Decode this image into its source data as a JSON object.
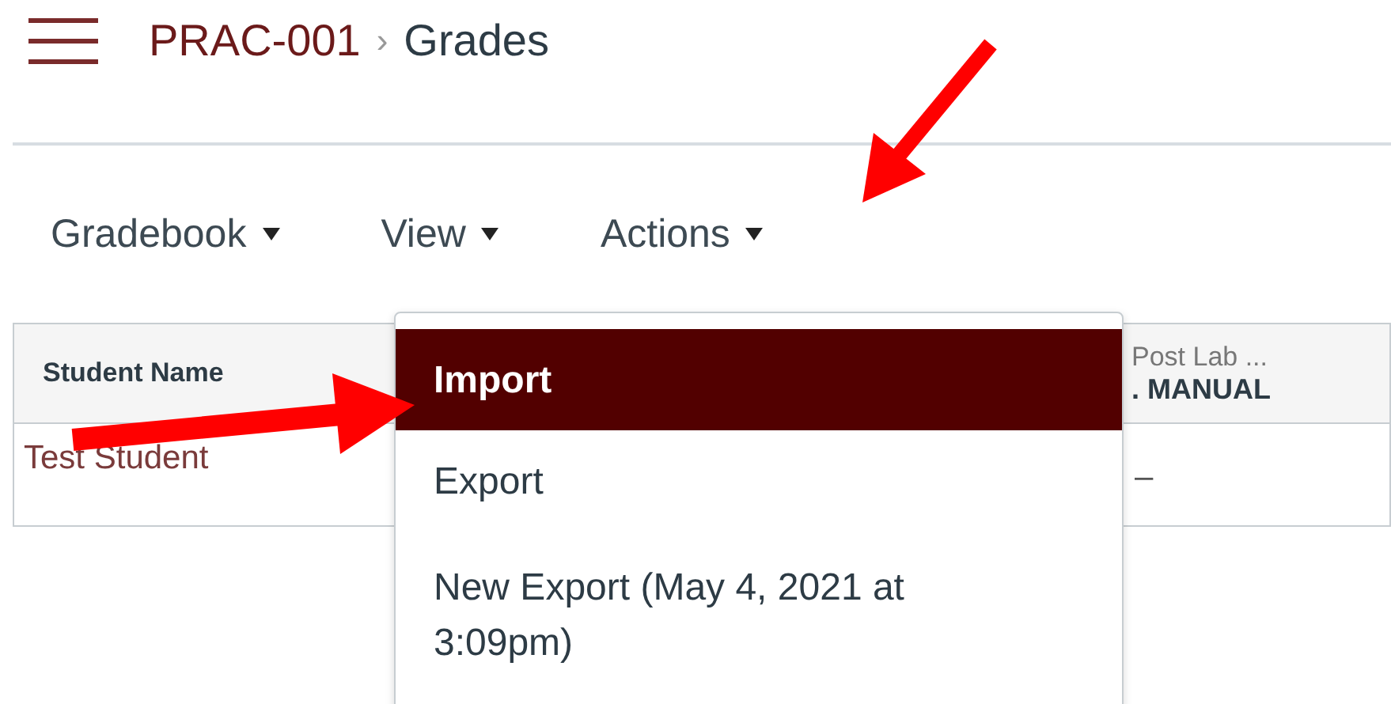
{
  "breadcrumb": {
    "course": "PRAC-001",
    "separator": "›",
    "page": "Grades"
  },
  "toolbar": [
    {
      "label": "Gradebook"
    },
    {
      "label": "View"
    },
    {
      "label": "Actions"
    }
  ],
  "table": {
    "columns": [
      {
        "title": "Student Name"
      },
      {
        "title": "Post Lab ...",
        "subtitle": ". MANUAL"
      }
    ],
    "rows": [
      {
        "cells": [
          "Test Student",
          "–"
        ]
      }
    ]
  },
  "actions_menu": [
    {
      "label": "Import",
      "selected": true
    },
    {
      "label": "Export",
      "selected": false
    },
    {
      "label": "New Export (May 4, 2021 at 3:09pm)",
      "selected": false
    }
  ]
}
